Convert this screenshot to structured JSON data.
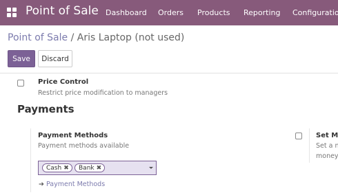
{
  "navbar": {
    "brand": "Point of Sale",
    "menu": [
      "Dashboard",
      "Orders",
      "Products",
      "Reporting",
      "Configuration"
    ]
  },
  "breadcrumb": {
    "parent": "Point of Sale",
    "separator": "/",
    "current": "Aris Laptop (not used)"
  },
  "actions": {
    "save_label": "Save",
    "discard_label": "Discard"
  },
  "price_control": {
    "title": "Price Control",
    "description": "Restrict price modification to managers"
  },
  "payments": {
    "section_title": "Payments",
    "payment_methods": {
      "title": "Payment Methods",
      "description": "Payment methods available",
      "tags": [
        "Cash",
        "Bank"
      ],
      "link_label": "Payment Methods"
    },
    "right_setting": {
      "title": "Set Ma",
      "desc_line1": "Set a n",
      "desc_line2": "money"
    }
  },
  "colors": {
    "brand": "#875a7b",
    "primary_button": "#7c6196",
    "link": "#7c7bad"
  },
  "icons": {
    "apps": "apps-grid-icon",
    "tag_remove": "close-icon",
    "dropdown": "caret-down-icon",
    "link_arrow": "arrow-right-icon"
  }
}
